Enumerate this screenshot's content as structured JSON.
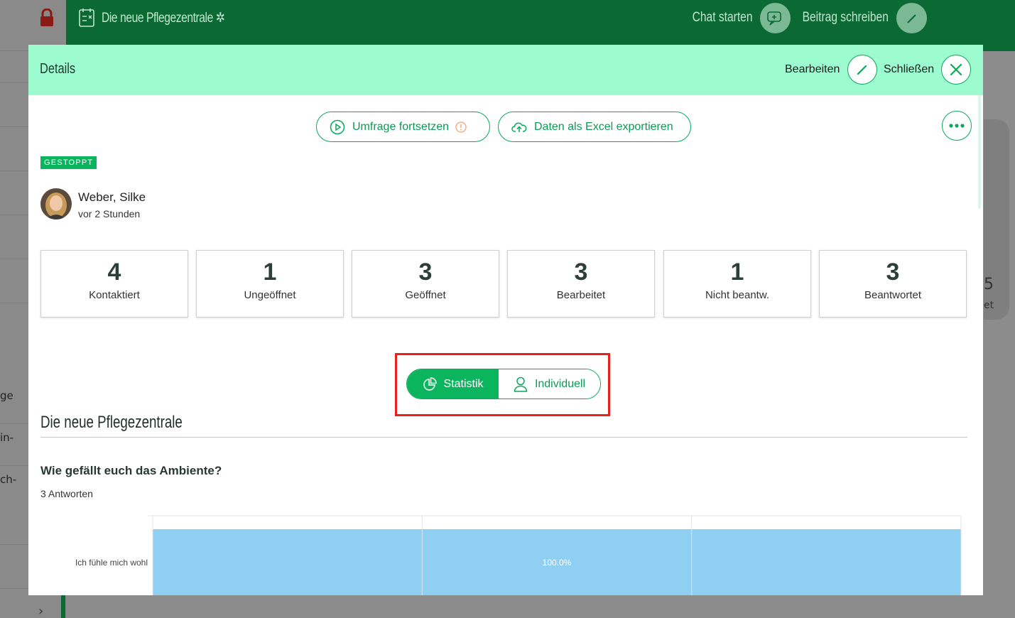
{
  "app": {
    "title": "Die neue Pflegezentrale",
    "chat_label": "Chat starten",
    "post_label": "Beitrag schreiben"
  },
  "background": {
    "left_fragments": [
      "ge",
      "in-",
      "ch-"
    ],
    "right_fragments": [
      "5",
      "et"
    ]
  },
  "modal": {
    "title": "Details",
    "edit_label": "Bearbeiten",
    "close_label": "Schließen",
    "continue_survey_label": "Umfrage fortsetzen",
    "export_label": "Daten als Excel exportieren",
    "status_badge": "GESTOPPT",
    "author": "Weber, Silke",
    "time": "vor 2 Stunden",
    "stats": [
      {
        "value": "4",
        "label": "Kontaktiert"
      },
      {
        "value": "1",
        "label": "Ungeöffnet"
      },
      {
        "value": "3",
        "label": "Geöffnet"
      },
      {
        "value": "3",
        "label": "Bearbeitet"
      },
      {
        "value": "1",
        "label": "Nicht beantw."
      },
      {
        "value": "3",
        "label": "Beantwortet"
      }
    ],
    "view_toggle": {
      "statistik": "Statistik",
      "individuell": "Individuell",
      "selected": "Statistik"
    },
    "section_title": "Die neue Pflegezentrale",
    "question": "Wie gefällt euch das Ambiente?",
    "answers_count": "3 Antworten"
  },
  "chart_data": {
    "type": "bar",
    "orientation": "horizontal",
    "categories": [
      "Ich fühle mich wohl"
    ],
    "values": [
      100.0
    ],
    "data_labels": [
      "100.0%"
    ],
    "xlim": [
      0,
      100
    ],
    "grid": true,
    "colors": {
      "bar": "#8fd0f2"
    }
  },
  "colors": {
    "accent": "#0ab55e",
    "header_bg": "#9cfbcf",
    "app_bar": "#0b6a34",
    "highlight": "#e8211c"
  }
}
